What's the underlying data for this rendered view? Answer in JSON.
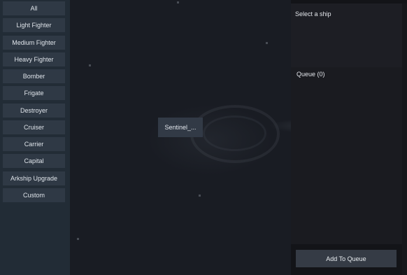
{
  "categories": [
    {
      "label": "All"
    },
    {
      "label": "Light Fighter"
    },
    {
      "label": "Medium Fighter"
    },
    {
      "label": "Heavy Fighter"
    },
    {
      "label": "Bomber"
    },
    {
      "label": "Frigate"
    },
    {
      "label": "Destroyer"
    },
    {
      "label": "Cruiser"
    },
    {
      "label": "Carrier"
    },
    {
      "label": "Capital"
    },
    {
      "label": "Arkship Upgrade"
    },
    {
      "label": "Custom"
    }
  ],
  "viewport": {
    "ship_chip_label": "Sentinel_..."
  },
  "panel": {
    "select_title": "Select a ship",
    "queue_title": "Queue (0)",
    "add_button_label": "Add To Queue"
  },
  "colors": {
    "accent": "#e050c0",
    "button_bg": "#2f3945",
    "panel_bg": "#1d1e24"
  }
}
